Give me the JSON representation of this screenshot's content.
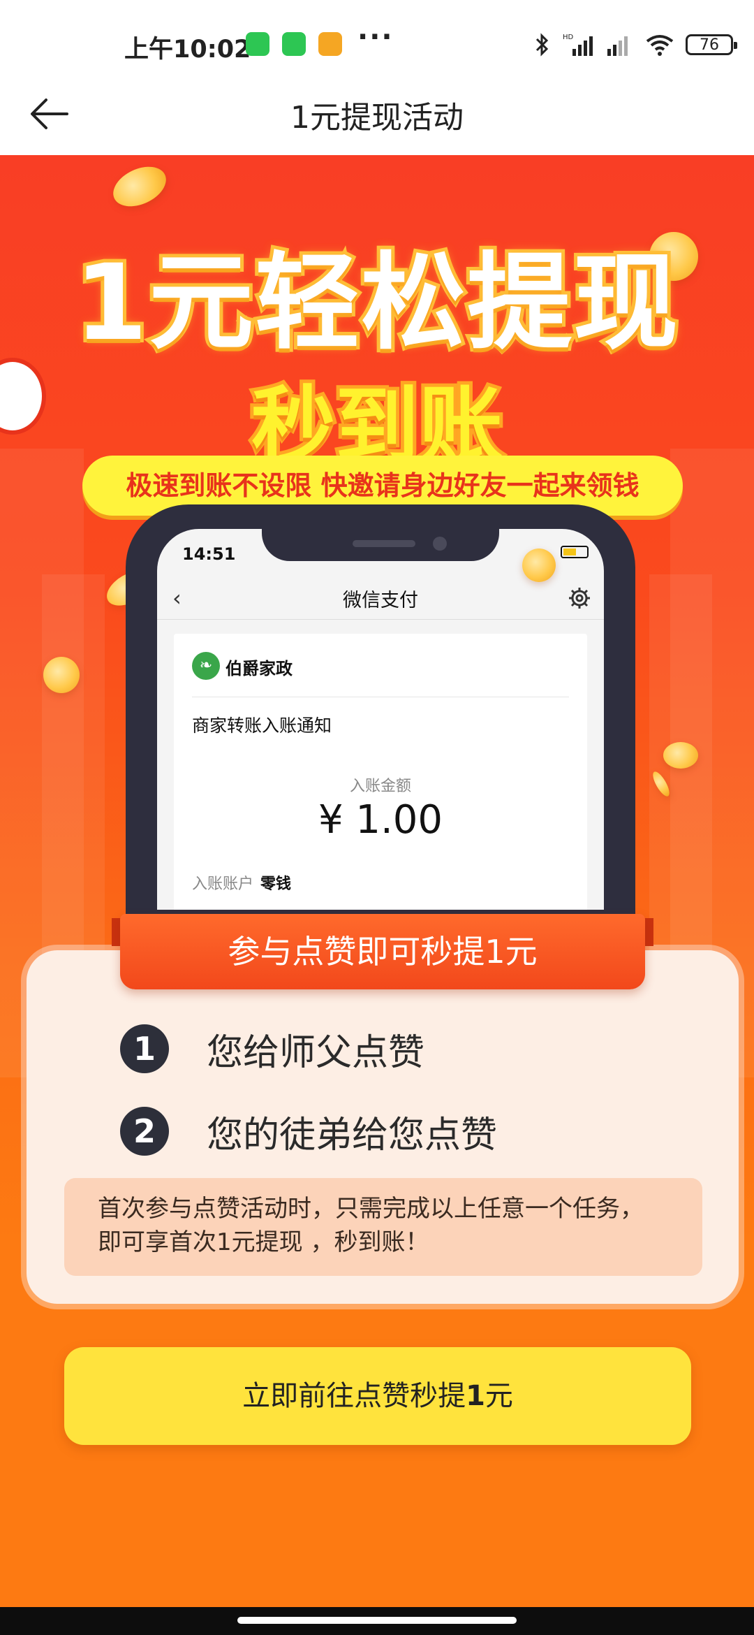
{
  "status_bar": {
    "time": "上午10:02",
    "more": "···",
    "network_hd": "HD",
    "battery": "76"
  },
  "nav": {
    "title": "1元提现活动"
  },
  "banner": {
    "headline": "1元轻松提现",
    "subheadline": "秒到账",
    "pill_text": "极速到账不设限 快邀请身边好友一起来领钱"
  },
  "phone_mockup": {
    "time": "14:51",
    "nav_title": "微信支付",
    "brand": "伯爵家政",
    "notice_title": "商家转账入账通知",
    "amount_label": "入账金额",
    "amount": "¥ 1.00",
    "account_label": "入账账户",
    "account_value": "零钱"
  },
  "tasks": {
    "ribbon": "参与点赞即可秒提1元",
    "items": [
      {
        "num": "1",
        "text": "您给师父点赞"
      },
      {
        "num": "2",
        "text": "您的徒弟给您点赞"
      }
    ],
    "note_line1": "首次参与点赞活动时，只需完成以上任意一个任务，",
    "note_line2": "即可享首次1元提现 ，秒到账！"
  },
  "cta": {
    "prefix": "立即前往点赞秒提",
    "amount": "1",
    "suffix": "元"
  },
  "colors": {
    "banner_top": "#f93e25",
    "banner_bottom": "#fd7a12",
    "cta_yellow": "#ffe33d",
    "ribbon": "#f2481b"
  }
}
